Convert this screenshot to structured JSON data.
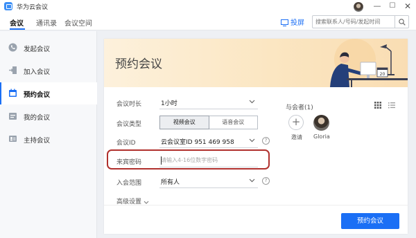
{
  "app": {
    "title": "华为云会议"
  },
  "colors": {
    "accent": "#1b6ff5",
    "highlight_border": "#b0302d",
    "banner": "#fbe6c2"
  },
  "nav": {
    "tabs": [
      {
        "label": "会议",
        "active": true
      },
      {
        "label": "通讯录",
        "active": false
      },
      {
        "label": "会议空间",
        "active": false
      }
    ],
    "cast_label": "投屏",
    "search_placeholder": "搜索联系人/号码/发起时间"
  },
  "sidebar": {
    "items": [
      {
        "label": "发起会议",
        "icon": "phone-icon",
        "active": false
      },
      {
        "label": "加入会议",
        "icon": "join-icon",
        "active": false
      },
      {
        "label": "预约会议",
        "icon": "calendar-icon",
        "active": true
      },
      {
        "label": "我的会议",
        "icon": "my-meetings-icon",
        "active": false
      },
      {
        "label": "主持会议",
        "icon": "host-icon",
        "active": false
      }
    ]
  },
  "form": {
    "title": "预约会议",
    "duration": {
      "label": "会议时长",
      "value": "1小时"
    },
    "type": {
      "label": "会议类型",
      "options": [
        "视频会议",
        "语音会议"
      ],
      "selected": "视频会议"
    },
    "meeting_id": {
      "label": "会议ID",
      "value": "云会议室ID 951 469 958",
      "help": "?"
    },
    "guest_password": {
      "label": "来宾密码",
      "placeholder": "请输入4-16位数字密码"
    },
    "scope": {
      "label": "入会范围",
      "value": "所有人",
      "help": "?"
    },
    "advanced_label": "高级设置",
    "submit_label": "预约会议",
    "calendar_date": "20"
  },
  "participants": {
    "title": "与会者(1)",
    "invite_label": "邀请",
    "members": [
      {
        "name": "Gloria"
      }
    ]
  }
}
